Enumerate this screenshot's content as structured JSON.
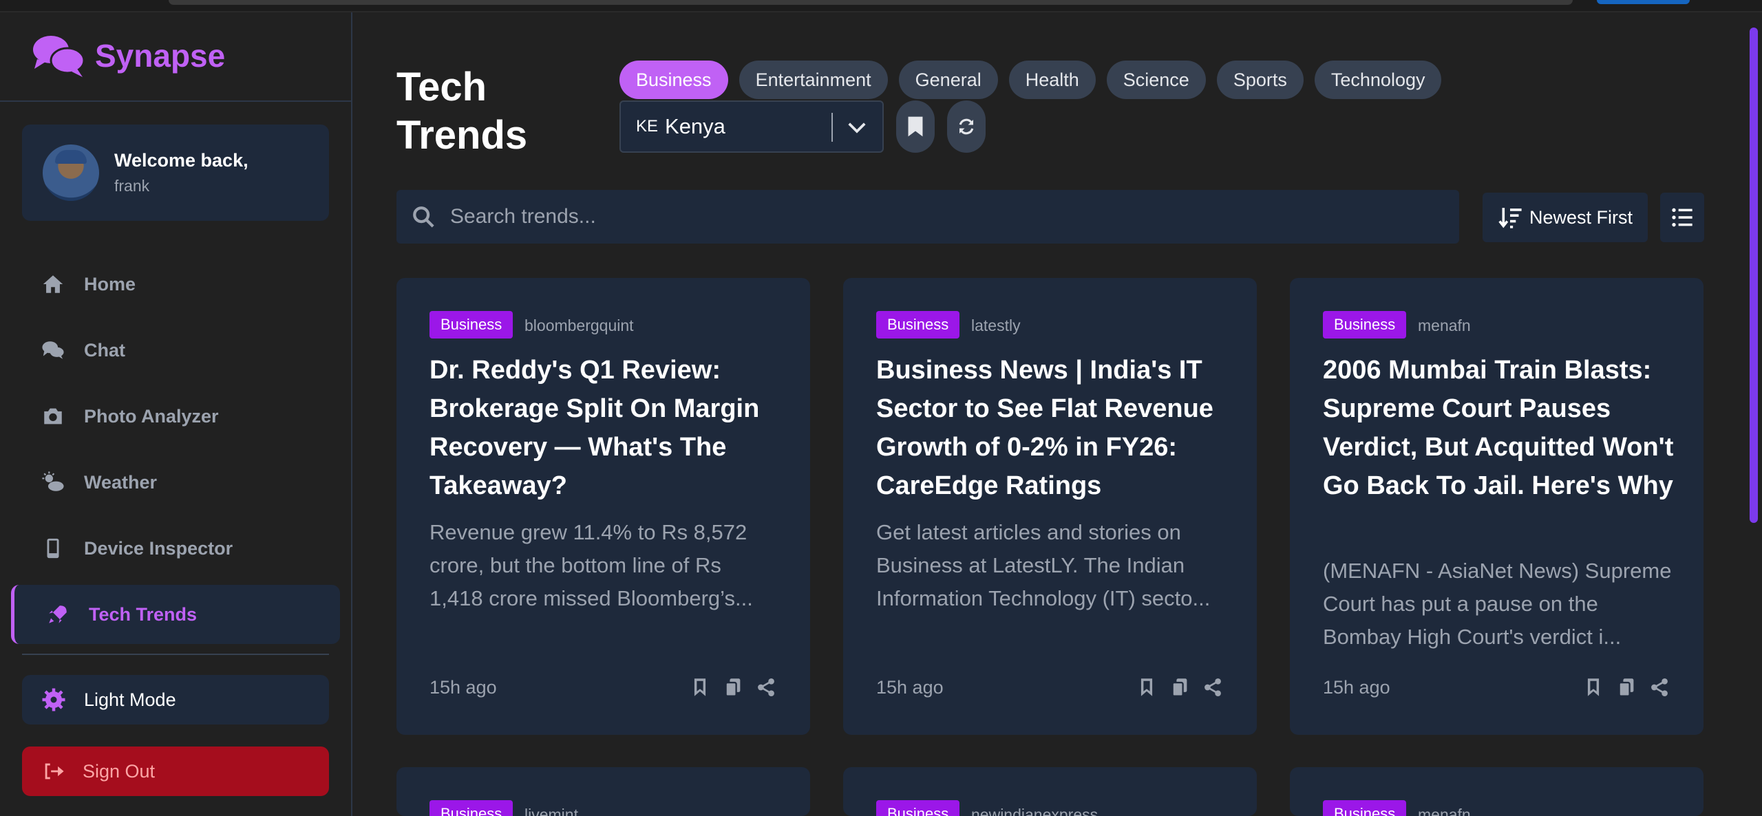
{
  "app": {
    "name": "Synapse",
    "accent": "#c061f5"
  },
  "user": {
    "greeting": "Welcome back,",
    "username": "frank"
  },
  "sidebar": {
    "items": [
      {
        "label": "Home",
        "icon": "home-icon"
      },
      {
        "label": "Chat",
        "icon": "chat-icon"
      },
      {
        "label": "Photo Analyzer",
        "icon": "camera-icon"
      },
      {
        "label": "Weather",
        "icon": "weather-icon"
      },
      {
        "label": "Device Inspector",
        "icon": "mobile-icon"
      },
      {
        "label": "Tech Trends",
        "icon": "rocket-icon",
        "active": true
      }
    ],
    "mode_label": "Light Mode",
    "signout_label": "Sign Out"
  },
  "page": {
    "title": "Tech Trends"
  },
  "categories": [
    "Business",
    "Entertainment",
    "General",
    "Health",
    "Science",
    "Sports",
    "Technology"
  ],
  "active_category": "Business",
  "country": {
    "flag": "KE",
    "name": "Kenya"
  },
  "search": {
    "placeholder": "Search trends..."
  },
  "sort": {
    "label": "Newest First"
  },
  "cards": [
    {
      "category": "Business",
      "source": "bloombergquint",
      "title": "Dr. Reddy's Q1 Review: Brokerage Split On Margin Recovery — What's The Takeaway?",
      "summary": "Revenue grew 11.4% to Rs 8,572 crore, but the bottom line of Rs 1,418 crore missed Bloomberg’s...",
      "time": "15h ago"
    },
    {
      "category": "Business",
      "source": "latestly",
      "title": "Business News | India's IT Sector to See Flat Revenue Growth of 0-2% in FY26: CareEdge Ratings",
      "summary": "Get latest articles and stories on Business at LatestLY. The Indian Information Technology (IT) secto...",
      "time": "15h ago"
    },
    {
      "category": "Business",
      "source": "menafn",
      "title": "2006 Mumbai Train Blasts: Supreme Court Pauses Verdict, But Acquitted Won't Go Back To Jail. Here's Why",
      "summary": "(MENAFN - AsiaNet News) Supreme Court has put a pause on the Bombay High Court's verdict i...",
      "time": "15h ago"
    },
    {
      "category": "Business",
      "source": "livemint"
    },
    {
      "category": "Business",
      "source": "newindianexpress"
    },
    {
      "category": "Business",
      "source": "menafn"
    }
  ]
}
